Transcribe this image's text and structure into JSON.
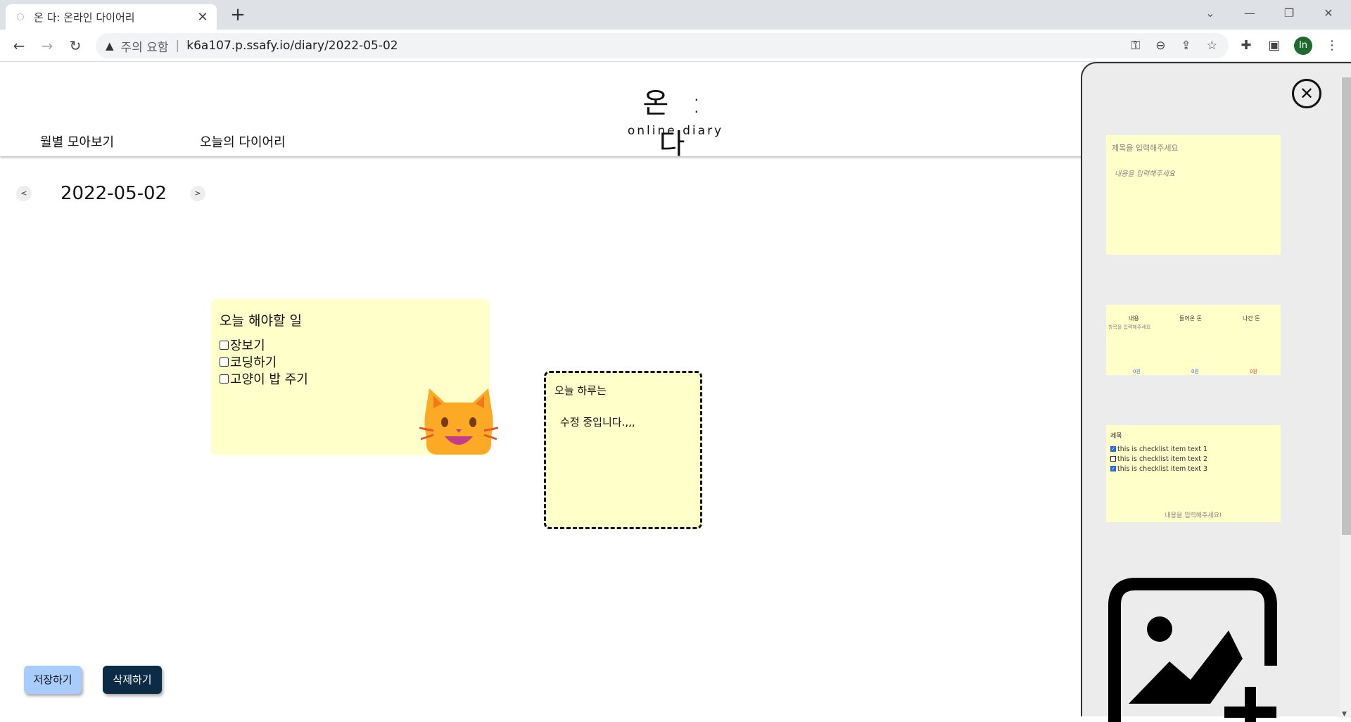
{
  "browser": {
    "tab_title": "온 다: 온라인 다이어리",
    "tab_close": "✕",
    "new_tab": "+",
    "warning_label": "주의 요함",
    "url": "k6a107.p.ssafy.io/diary/2022-05-02",
    "avatar_initials": "In"
  },
  "header": {
    "logo_main": "온 : 다",
    "logo_sub": "online diary",
    "nav": [
      "월별 모아보기",
      "오늘의 다이어리"
    ]
  },
  "date_nav": {
    "prev": "<",
    "date": "2022-05-02",
    "next": ">"
  },
  "todo_card": {
    "title": "오늘 해야할 일",
    "items": [
      "장보기",
      "코딩하기",
      "고양이 밥 주기"
    ]
  },
  "edit_card": {
    "title": "오늘 하루는",
    "body": "수정 중입니다.,,,"
  },
  "buttons": {
    "save": "저장하기",
    "delete": "삭제하기"
  },
  "panel": {
    "close": "✕",
    "template_note": {
      "title_placeholder": "제목을 입력해주세요",
      "body_placeholder": "내용을 입력해주세요"
    },
    "template_ledger": {
      "columns": [
        "내용",
        "들어온 돈",
        "나간 돈"
      ],
      "placeholder": "항목을 입력해주세요",
      "totals": [
        "0원",
        "0원",
        "0원"
      ]
    },
    "template_checklist": {
      "title": "제목",
      "items": [
        {
          "text": "this is checklist item text 1",
          "checked": true
        },
        {
          "text": "this is checklist item text 2",
          "checked": false
        },
        {
          "text": "this is checklist item text 3",
          "checked": true
        }
      ],
      "footer": "내용을 입력해주세요!"
    }
  },
  "colors": {
    "note_bg": "#ffffc9",
    "save_btn": "#a8cdfc",
    "delete_btn": "#0c2b46"
  }
}
